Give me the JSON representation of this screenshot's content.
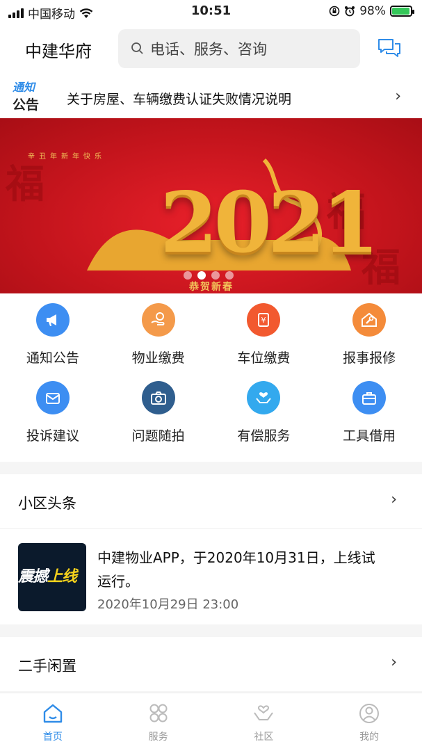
{
  "status_bar": {
    "carrier": "中国移动",
    "time": "10:51",
    "battery": "98%",
    "battery_level": 0.98
  },
  "header": {
    "brand": "中建华府",
    "search_placeholder": "电话、服务、咨询"
  },
  "notice": {
    "logo_top": "通知",
    "logo_bottom": "公告",
    "text": "关于房屋、车辆缴费认证失败情况说明"
  },
  "banner": {
    "top_text": "辛丑年新年快乐",
    "year": "2021",
    "greeting": "恭贺新春",
    "slide_count": 4,
    "active_slide": 2
  },
  "services": [
    {
      "label": "通知公告",
      "icon": "megaphone-icon",
      "color": "#3d8ef2"
    },
    {
      "label": "物业缴费",
      "icon": "hand-coin-icon",
      "color": "#f49a4a"
    },
    {
      "label": "车位缴费",
      "icon": "parking-fee-icon",
      "color": "#f2592f"
    },
    {
      "label": "报事报修",
      "icon": "wrench-house-icon",
      "color": "#f48b3a"
    },
    {
      "label": "投诉建议",
      "icon": "envelope-icon",
      "color": "#3d8ef2"
    },
    {
      "label": "问题随拍",
      "icon": "camera-icon",
      "color": "#2f5e8e"
    },
    {
      "label": "有偿服务",
      "icon": "heart-hands-icon",
      "color": "#33a9ee"
    },
    {
      "label": "工具借用",
      "icon": "toolbox-icon",
      "color": "#3d8ef2"
    }
  ],
  "section_headlines": {
    "title": "小区头条"
  },
  "news": {
    "title": "中建物业APP，于2020年10月31日，上线试运行。",
    "date": "2020年10月29日 23:00",
    "thumb_text_a": "震撼",
    "thumb_text_b": "上线"
  },
  "section_secondhand": {
    "title": "二手闲置"
  },
  "tabbar": [
    {
      "label": "首页",
      "icon": "home-icon",
      "active": true
    },
    {
      "label": "服务",
      "icon": "grid-icon",
      "active": false
    },
    {
      "label": "社区",
      "icon": "community-icon",
      "active": false
    },
    {
      "label": "我的",
      "icon": "profile-icon",
      "active": false
    }
  ],
  "colors": {
    "accent": "#2f8ce8",
    "banner_red": "#d0181f",
    "gold": "#f0b43a"
  }
}
